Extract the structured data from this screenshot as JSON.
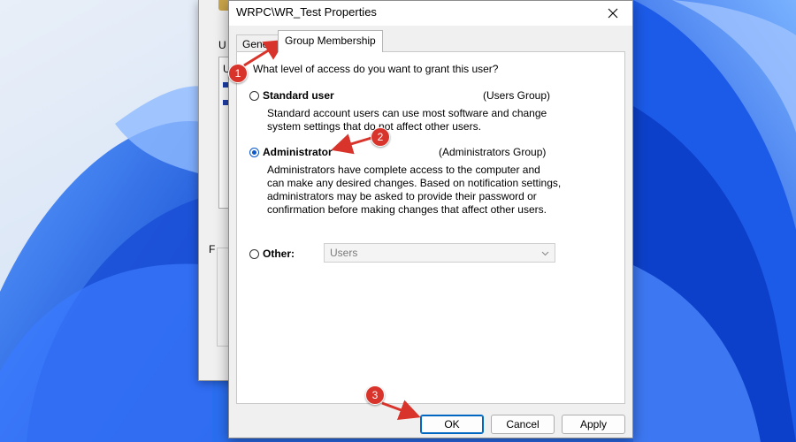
{
  "dialog": {
    "title": "WRPC\\WR_Test Properties",
    "tabs": [
      {
        "label": "General",
        "active": false
      },
      {
        "label": "Group Membership",
        "active": true
      }
    ],
    "question": "What level of access do you want to grant this user?",
    "options": {
      "standard": {
        "label": "Standard user",
        "group": "(Users Group)",
        "desc_lines": [
          "Standard account users can use most software and change",
          "system settings that do not affect other users."
        ],
        "selected": false
      },
      "administrator": {
        "label": "Administrator",
        "group": "(Administrators Group)",
        "desc_lines": [
          "Administrators have complete access to the computer and",
          "can make any desired changes. Based on notification settings,",
          "administrators may be asked to provide their password or",
          "confirmation before making changes that affect other users."
        ],
        "selected": true
      },
      "other": {
        "label": "Other:",
        "select_value": "Users",
        "selected": false
      }
    },
    "buttons": {
      "ok": "OK",
      "cancel": "Cancel",
      "apply": "Apply"
    }
  },
  "background_window": {
    "partial_label_top": "U",
    "listbox_partial": "U",
    "partial_label_bottom": "F"
  },
  "annotations": [
    {
      "number": "1",
      "target": "Group Membership tab"
    },
    {
      "number": "2",
      "target": "Administrator option"
    },
    {
      "number": "3",
      "target": "OK button"
    }
  ],
  "colors": {
    "accent": "#0a58c9",
    "annotation_red": "#d9342b",
    "wallpaper_blue": "#2a6ef0",
    "dialog_bg": "#f0f0f0"
  }
}
